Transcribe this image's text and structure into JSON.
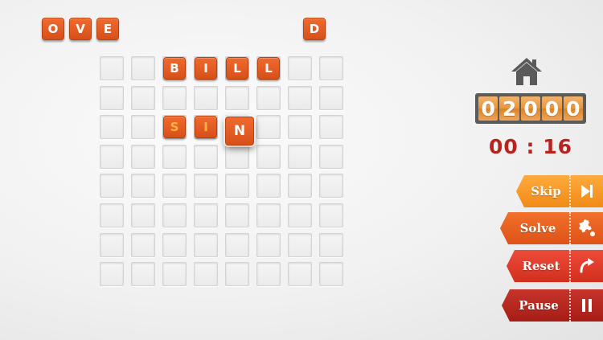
{
  "tray": {
    "tiles": [
      {
        "letter": "O"
      },
      {
        "letter": "V"
      },
      {
        "letter": "E"
      },
      {
        "letter": "D"
      }
    ]
  },
  "board": {
    "rows": 8,
    "cols": 8,
    "placed": [
      {
        "letter": "B",
        "row": 0,
        "col": 2,
        "style": "placed"
      },
      {
        "letter": "I",
        "row": 0,
        "col": 3,
        "style": "placed"
      },
      {
        "letter": "L",
        "row": 0,
        "col": 4,
        "style": "placed"
      },
      {
        "letter": "L",
        "row": 0,
        "col": 5,
        "style": "placed"
      },
      {
        "letter": "S",
        "row": 2,
        "col": 2,
        "style": "hint"
      },
      {
        "letter": "I",
        "row": 2,
        "col": 3,
        "style": "hint"
      },
      {
        "letter": "N",
        "row": 2,
        "col": 4,
        "style": "active"
      }
    ]
  },
  "hud": {
    "home_icon": "home-icon",
    "score_digits": [
      "0",
      "2",
      "0",
      "0",
      "0"
    ],
    "timer": "00 : 16"
  },
  "buttons": {
    "skip": {
      "label": "Skip",
      "icon": "skip-next-icon"
    },
    "solve": {
      "label": "Solve",
      "icon": "puzzle-piece-icon"
    },
    "reset": {
      "label": "Reset",
      "icon": "redo-arrow-icon"
    },
    "pause": {
      "label": "Pause",
      "icon": "pause-icon"
    }
  },
  "colors": {
    "tile": "#e35e23",
    "hint_letter": "#ffb340",
    "timer": "#b8231d",
    "skip": "#f79a26",
    "solve": "#e65f1f",
    "reset": "#e03e2c",
    "pause": "#b3261f"
  }
}
